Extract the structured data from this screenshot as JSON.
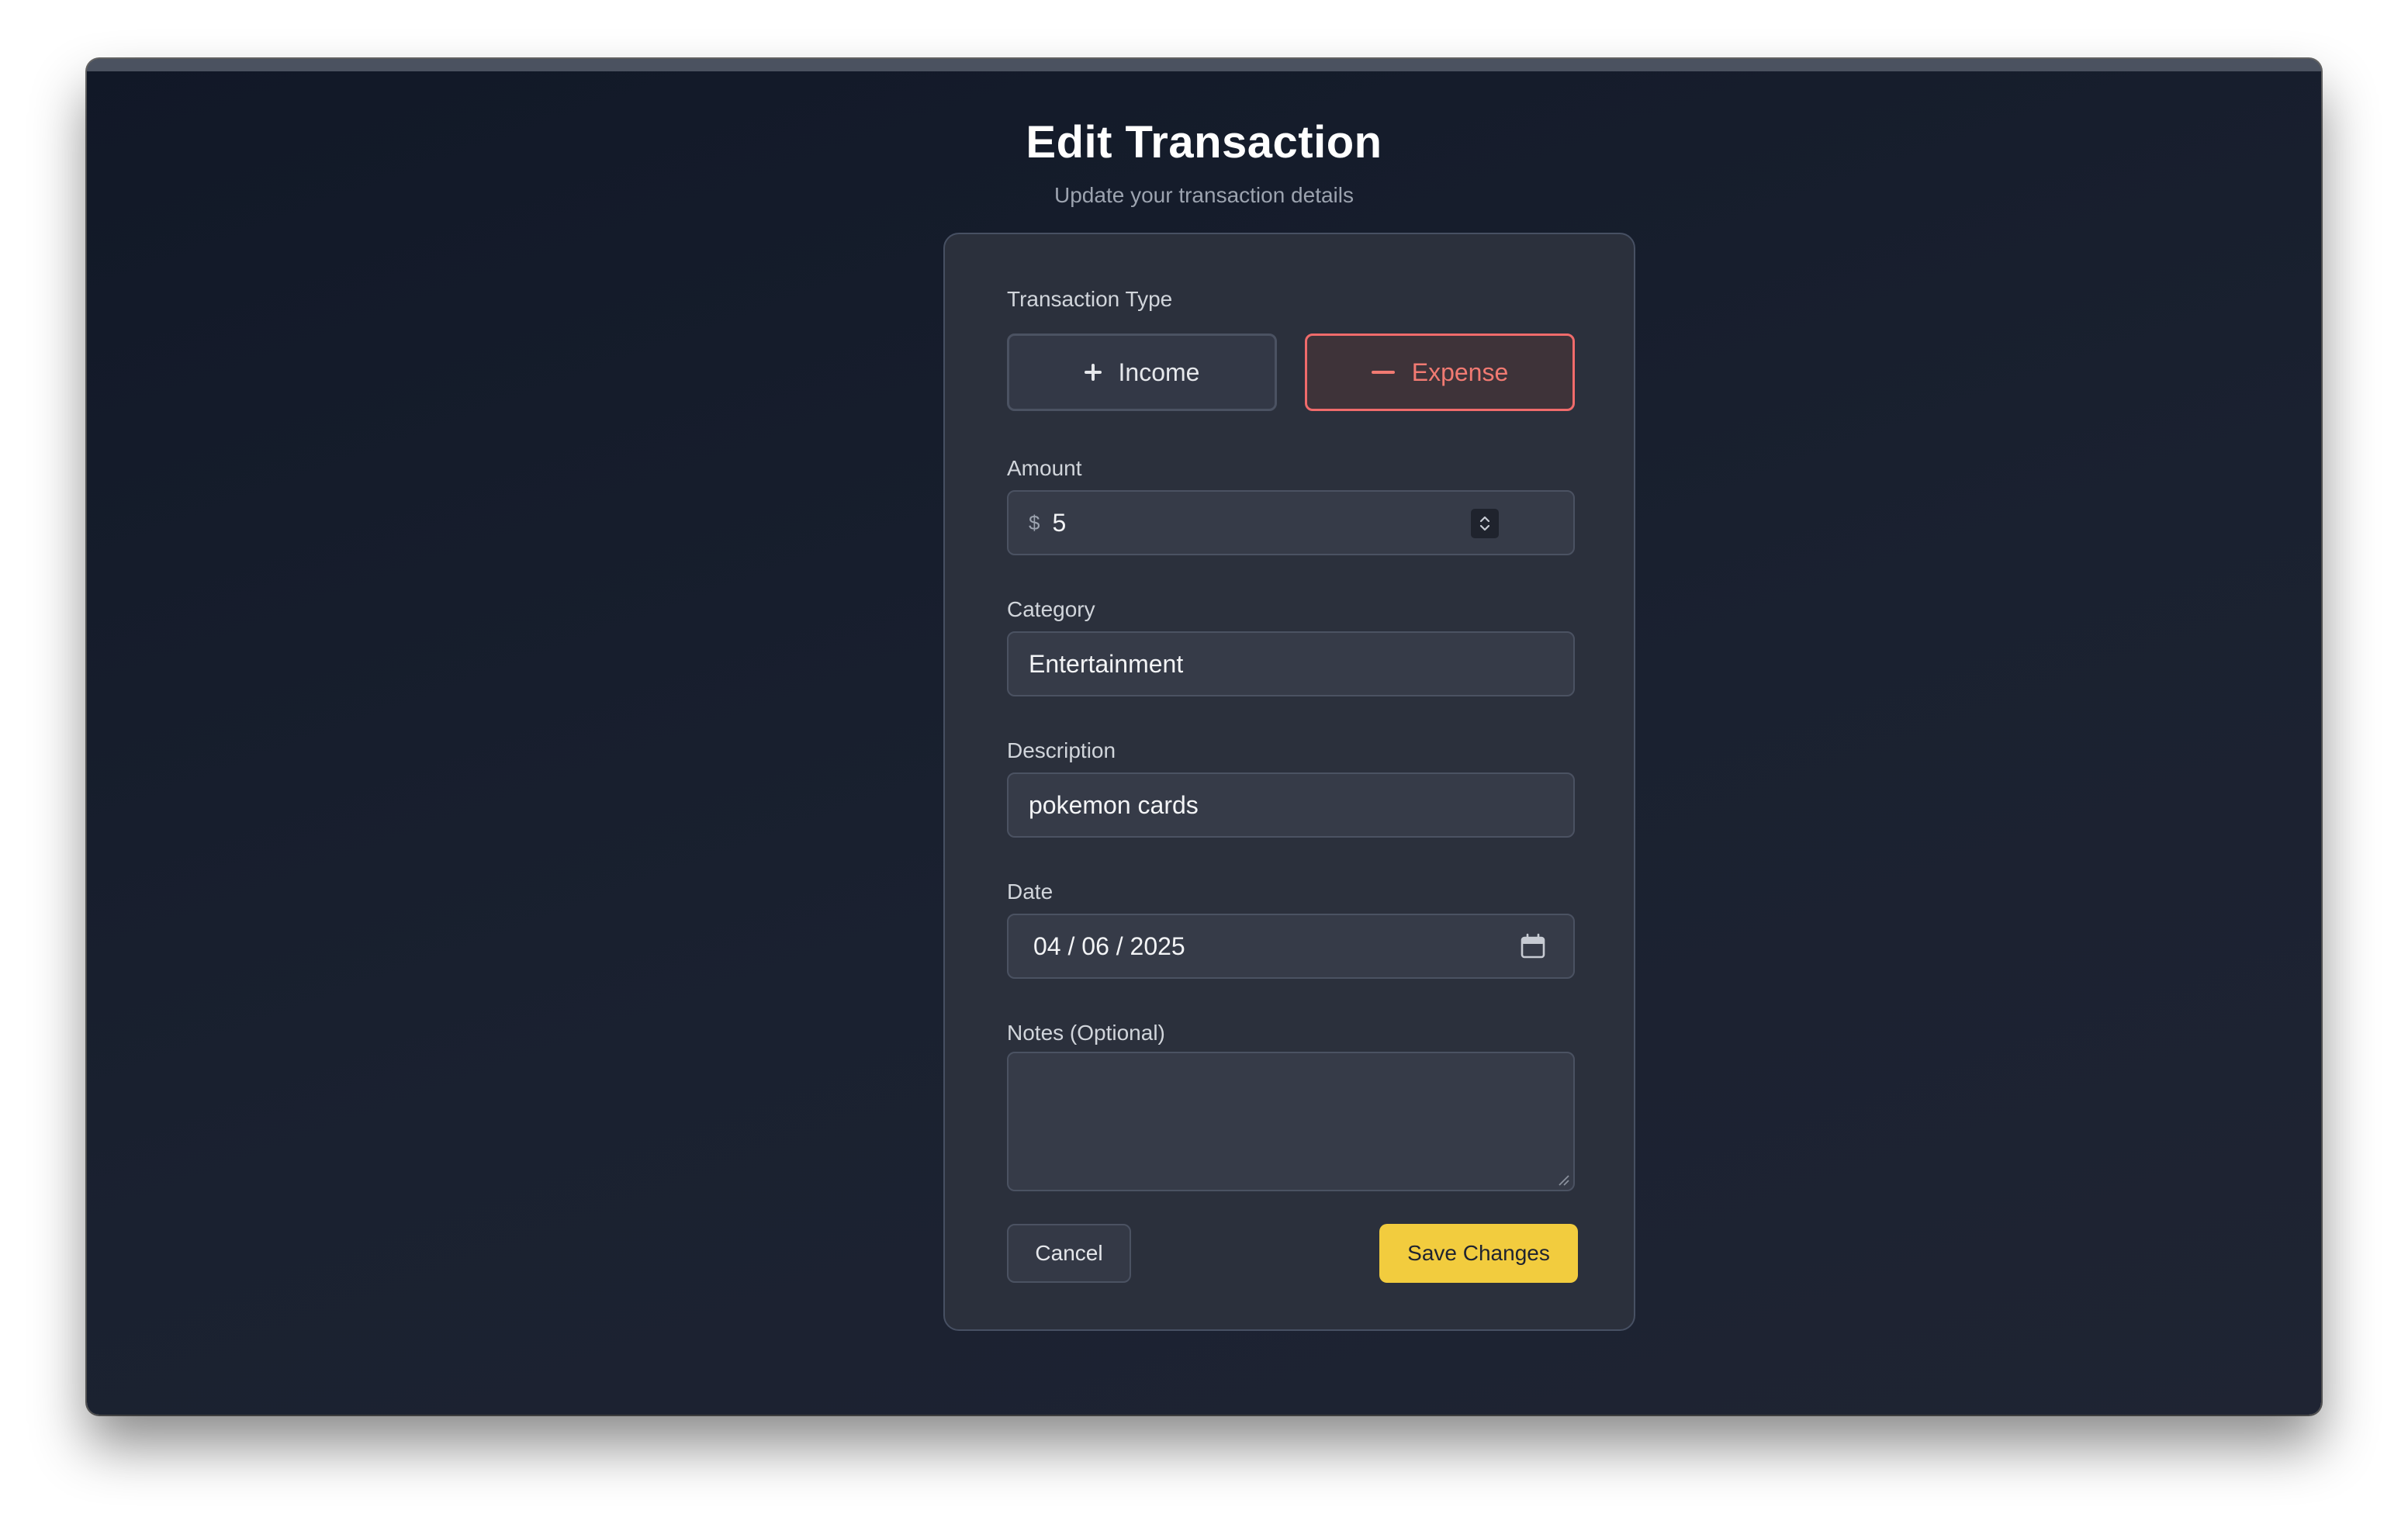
{
  "header": {
    "title": "Edit Transaction",
    "subtitle": "Update your transaction details"
  },
  "form": {
    "transaction_type": {
      "label": "Transaction Type",
      "options": [
        {
          "label": "Income",
          "icon": "plus-icon",
          "selected": false
        },
        {
          "label": "Expense",
          "icon": "minus-icon",
          "selected": true
        }
      ]
    },
    "amount": {
      "label": "Amount",
      "currency_symbol": "$",
      "value": "5"
    },
    "category": {
      "label": "Category",
      "value": "Entertainment"
    },
    "description": {
      "label": "Description",
      "value": "pokemon cards"
    },
    "date": {
      "label": "Date",
      "value": "04 / 06 / 2025",
      "icon": "calendar-icon"
    },
    "notes": {
      "label": "Notes (Optional)",
      "value": ""
    }
  },
  "actions": {
    "cancel_label": "Cancel",
    "save_label": "Save Changes"
  },
  "colors": {
    "expense_accent": "#f06b6b",
    "save_button": "#f2cc3e",
    "background": "#1a2130",
    "card": "#2b303c"
  }
}
